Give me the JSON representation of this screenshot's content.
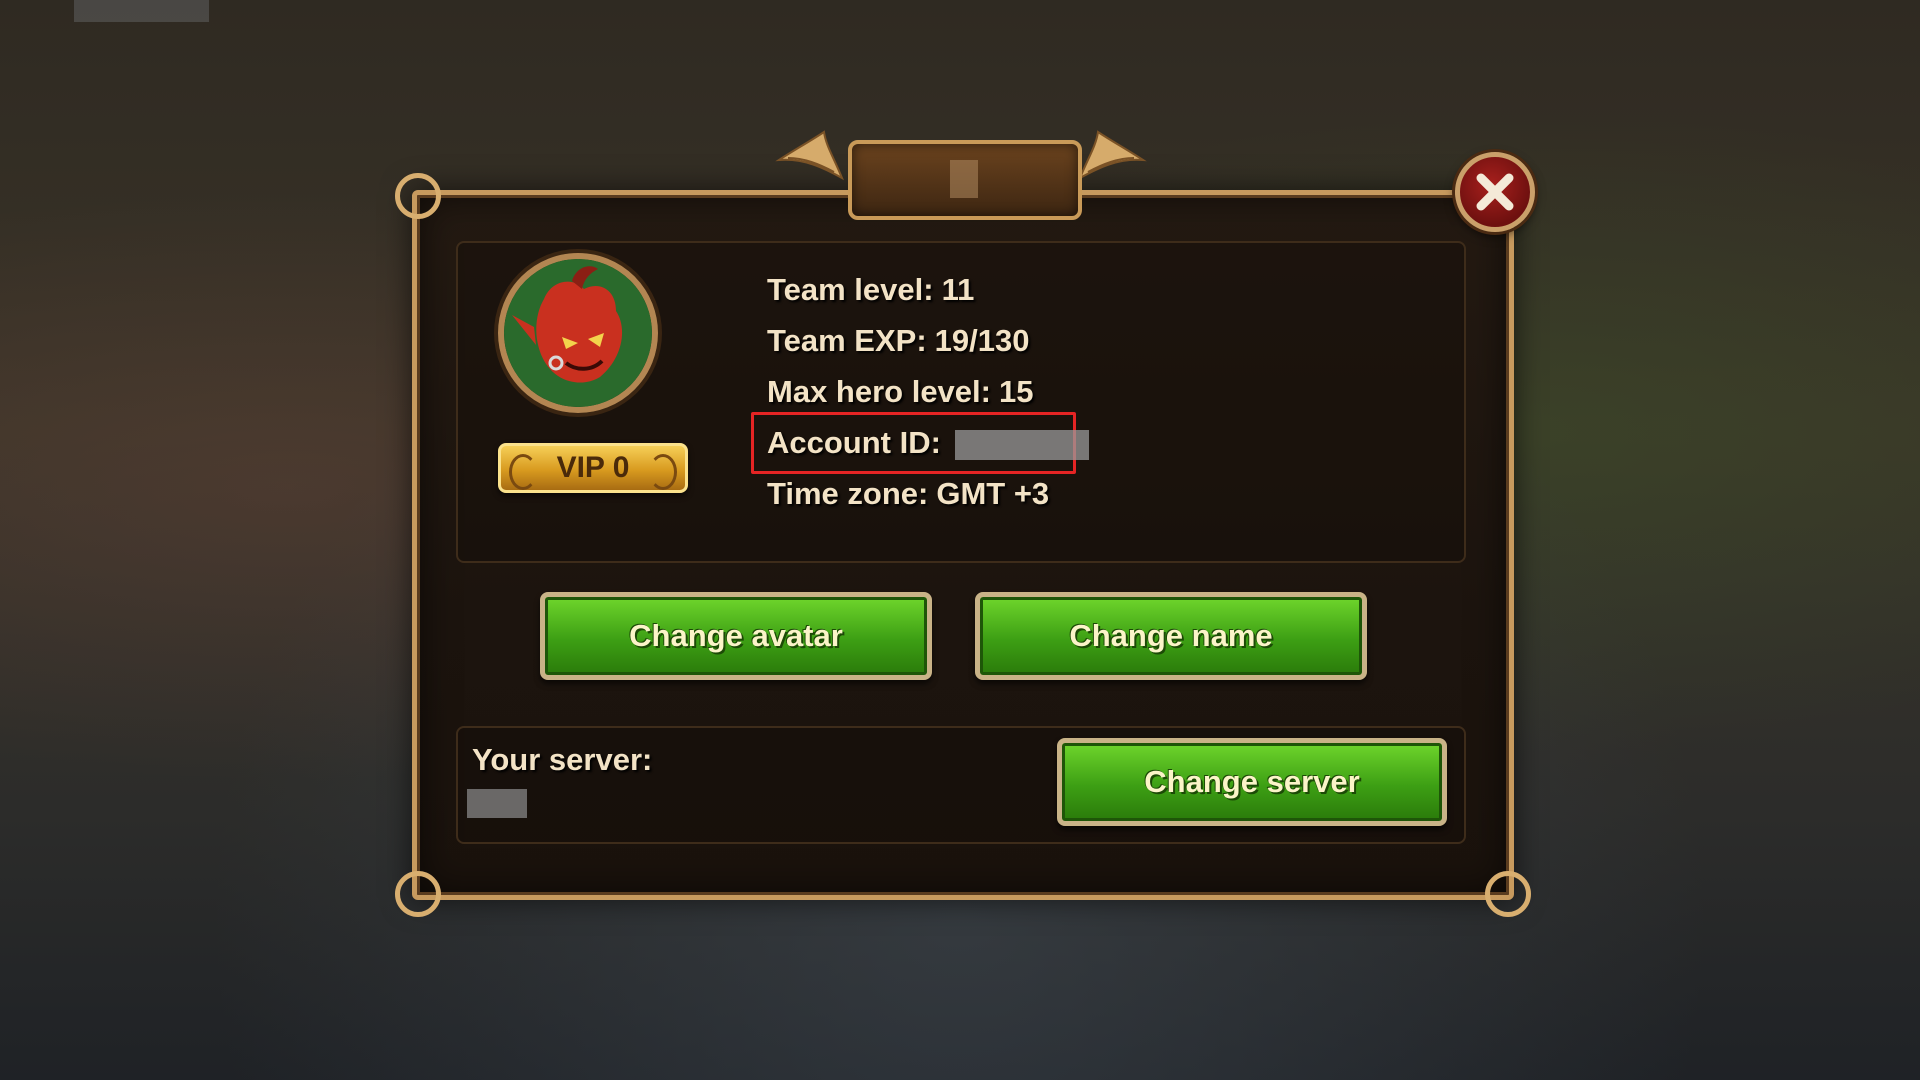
{
  "profile": {
    "team_level_label": "Team level:",
    "team_level_value": "11",
    "team_exp_label": "Team EXP:",
    "team_exp_value": "19/130",
    "max_hero_level_label": "Max hero level:",
    "max_hero_level_value": "15",
    "account_id_label": "Account ID:",
    "time_zone_label": "Time zone:",
    "time_zone_value": "GMT +3",
    "vip_label": "VIP 0"
  },
  "buttons": {
    "change_avatar": "Change avatar",
    "change_name": "Change name",
    "change_server": "Change server"
  },
  "server": {
    "label": "Your server:"
  },
  "colors": {
    "highlight_box": "#e52424",
    "button_green": "#3d9f14",
    "frame_gold": "#c79a5e",
    "close_red": "#a8201d"
  },
  "icons": {
    "close": "close-x-icon",
    "avatar": "demon-hero-avatar"
  }
}
